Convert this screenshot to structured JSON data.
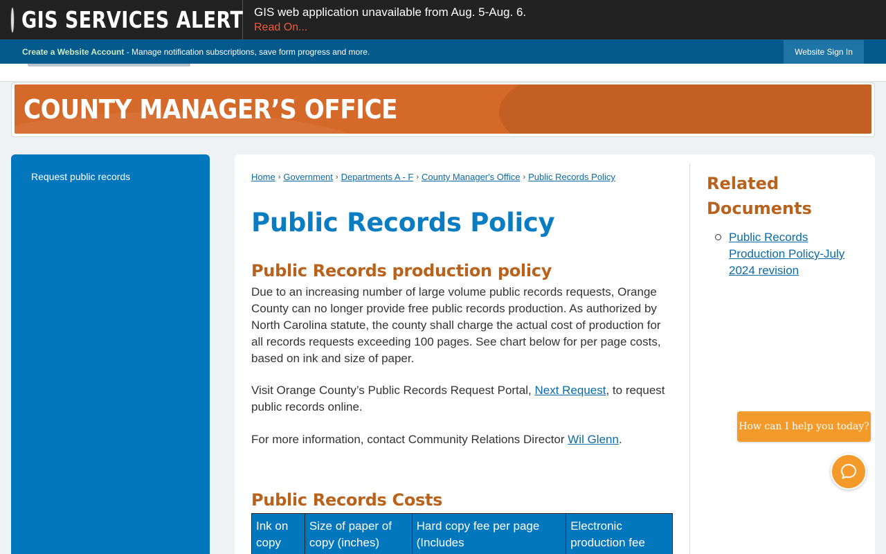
{
  "alert": {
    "title": "GIS SERVICES ALERT",
    "message": "GIS web application unavailable from Aug. 5-Aug. 6.",
    "link": "Read On..."
  },
  "account_bar": {
    "create_link": "Create a Website Account",
    "description": " - Manage notification subscriptions, save form progress and more.",
    "sign_in": "Website Sign In"
  },
  "banner": {
    "title": "COUNTY MANAGER’S OFFICE"
  },
  "sidebar": {
    "items": [
      {
        "label": "Request public records"
      }
    ]
  },
  "breadcrumb": [
    "Home",
    "Government",
    "Departments A - F",
    "County Manager's Office",
    "Public Records Policy"
  ],
  "main": {
    "page_title": "Public Records Policy",
    "policy_heading": "Public Records production policy",
    "policy_text": "Due to an increasing number of large volume public records requests, Orange County can no longer provide free public records production. As authorized by North Carolina statute, the county shall charge the actual cost of production for all records requests exceeding 100 pages. See chart below for per page costs, based on ink and size of paper.",
    "portal_text_before": "Visit Orange County’s Public Records Request Portal, ",
    "portal_link": "Next Request",
    "portal_text_after": ", to request public records online.",
    "contact_text_before": "For more information, contact Community Relations Director ",
    "contact_link": "Wil Glenn",
    "contact_text_after": ".",
    "costs_heading": "Public Records Costs",
    "costs_table_headers": [
      "Ink on copy",
      "Size of paper of copy (inches)",
      "Hard copy fee per page (Includes",
      "Electronic production fee"
    ]
  },
  "related": {
    "title": "Related Documents",
    "documents": [
      "Public Records Production Policy-July 2024 revision"
    ]
  },
  "chat": {
    "prompt": "How can I help you today?"
  },
  "colors": {
    "alert_bg": "#222222",
    "account_bar_bg": "#045a8d",
    "banner_bg": "#d5692a",
    "sidebar_bg": "#0277bd",
    "title_blue": "#0a7cc1",
    "heading_orange": "#b8621b",
    "chat_orange": "#f39a2b"
  }
}
